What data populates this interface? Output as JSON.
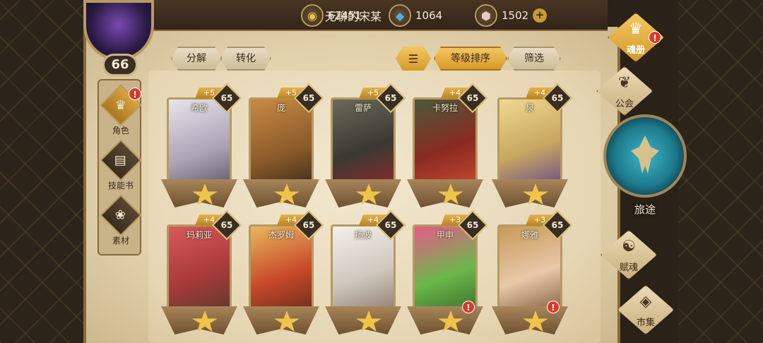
{
  "player": {
    "name": "无聊的宋某",
    "level": "66"
  },
  "currencies": [
    {
      "icon": "gold-coin-icon",
      "value": "62451"
    },
    {
      "icon": "blue-crystal-icon",
      "value": "1064"
    },
    {
      "icon": "pink-gem-icon",
      "value": "1502"
    }
  ],
  "actions": {
    "decompose": "分解",
    "transform": "转化",
    "sort_by_level": "等级排序",
    "filter": "筛选"
  },
  "left_nav": [
    {
      "label": "角色",
      "icon": "helmet-icon",
      "active": true,
      "alert": true
    },
    {
      "label": "技能书",
      "icon": "skill-book-icon",
      "active": false,
      "alert": false
    },
    {
      "label": "素材",
      "icon": "material-icon",
      "active": false,
      "alert": false
    }
  ],
  "right_nav": {
    "soul_book": "魂册",
    "guild": "公会",
    "journey": "旅途",
    "talent": "赋魂",
    "market": "市集"
  },
  "cards": [
    {
      "name": "希欧",
      "plus": "+5",
      "level": "65",
      "alert": false
    },
    {
      "name": "庞",
      "plus": "+5",
      "level": "65",
      "alert": false
    },
    {
      "name": "雷萨",
      "plus": "+5",
      "level": "65",
      "alert": false
    },
    {
      "name": "卡努拉",
      "plus": "+4",
      "level": "65",
      "alert": false
    },
    {
      "name": "泉",
      "plus": "+4",
      "level": "65",
      "alert": false
    },
    {
      "name": "玛莉亚",
      "plus": "+4",
      "level": "65",
      "alert": false
    },
    {
      "name": "杰罗姆",
      "plus": "+4",
      "level": "65",
      "alert": false
    },
    {
      "name": "扬波",
      "plus": "+4",
      "level": "65",
      "alert": false
    },
    {
      "name": "甲申",
      "plus": "+3",
      "level": "65",
      "alert": true
    },
    {
      "name": "娜雅",
      "plus": "+3",
      "level": "65",
      "alert": true
    }
  ],
  "alert_mark": "!",
  "plus_symbol": "+",
  "colors": {
    "accent_gold": "#f4c661",
    "alert_red": "#d9392a",
    "parchment": "#ece0c4"
  }
}
